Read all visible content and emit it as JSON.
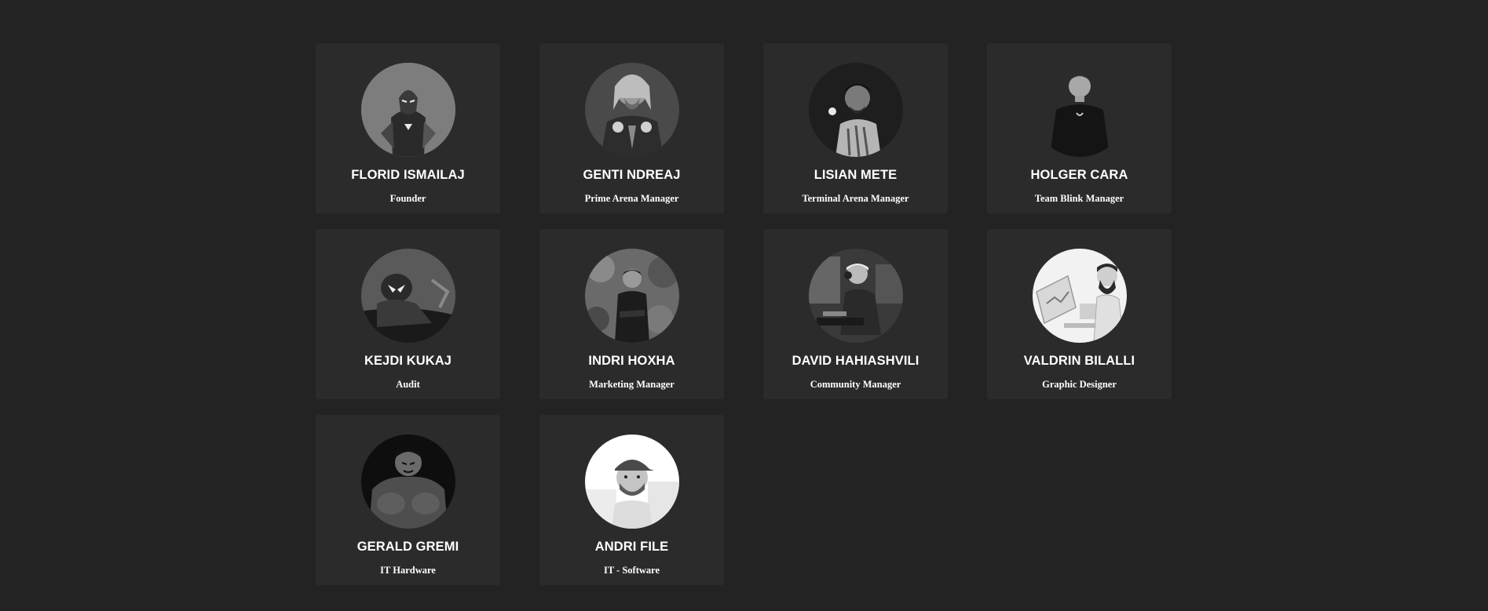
{
  "team": {
    "members": [
      {
        "name": "FLORID ISMAILAJ",
        "role": "Founder",
        "avatar": "iron-man-avatar"
      },
      {
        "name": "GENTI NDREAJ",
        "role": "Prime Arena Manager",
        "avatar": "thor-avatar"
      },
      {
        "name": "LISIAN METE",
        "role": "Terminal Arena Manager",
        "avatar": "person-portrait-avatar"
      },
      {
        "name": "HOLGER CARA",
        "role": "Team Blink Manager",
        "avatar": "person-portrait-avatar"
      },
      {
        "name": "KEJDI KUKAJ",
        "role": "Audit",
        "avatar": "spider-man-avatar"
      },
      {
        "name": "INDRI HOXHA",
        "role": "Marketing Manager",
        "avatar": "person-portrait-avatar"
      },
      {
        "name": "DAVID HAHIASHVILI",
        "role": "Community Manager",
        "avatar": "gamer-at-desk-avatar"
      },
      {
        "name": "VALDRIN BILALLI",
        "role": "Graphic Designer",
        "avatar": "designer-illustration-avatar"
      },
      {
        "name": "GERALD GREMI",
        "role": "IT Hardware",
        "avatar": "hulk-avatar"
      },
      {
        "name": "ANDRI FILE",
        "role": "IT - Software",
        "avatar": "person-with-cap-avatar"
      }
    ]
  },
  "colors": {
    "background": "#232323",
    "card": "#2b2b2b",
    "text": "#ffffff"
  }
}
